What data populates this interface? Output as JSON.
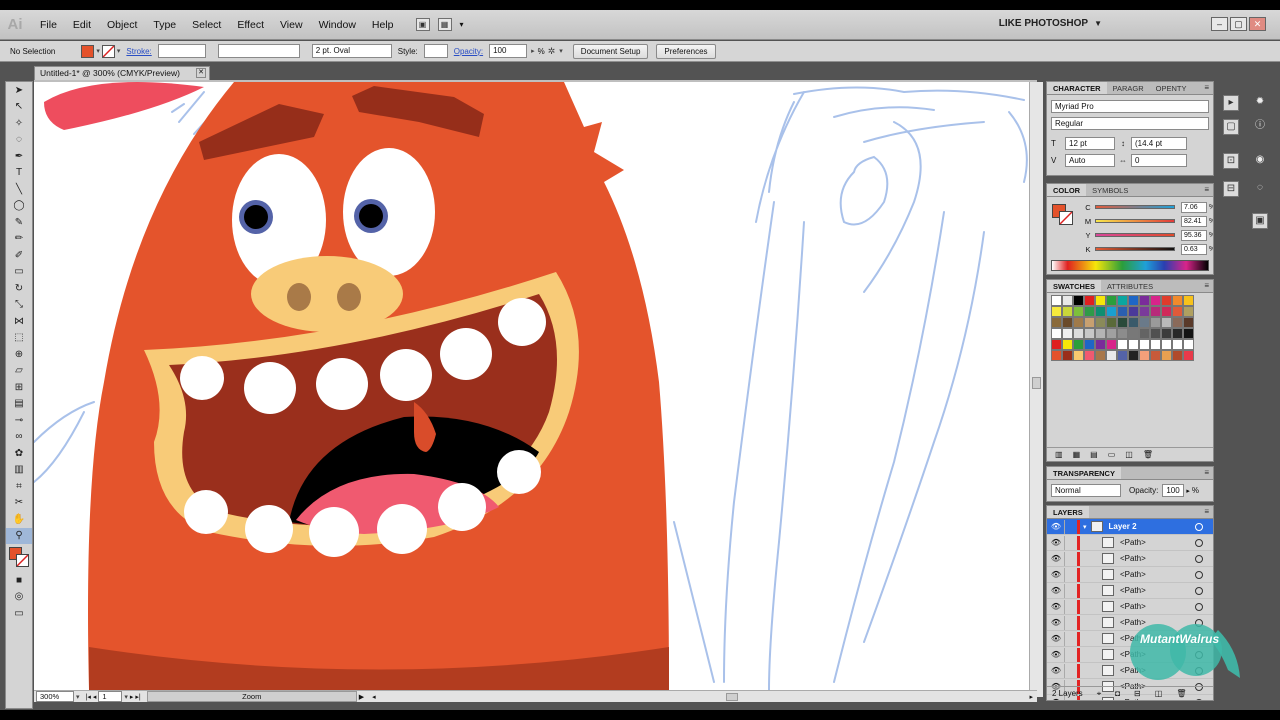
{
  "app": {
    "logo": "Ai",
    "workspace": "LIKE PHOTOSHOP"
  },
  "menu": [
    "File",
    "Edit",
    "Object",
    "Type",
    "Select",
    "Effect",
    "View",
    "Window",
    "Help"
  ],
  "window_buttons": [
    "–",
    "▢",
    "✕"
  ],
  "control": {
    "selection": "No Selection",
    "fill_color": "#e4522b",
    "stroke_label": "Stroke:",
    "brush": "2 pt. Oval",
    "style_label": "Style:",
    "opacity_label": "Opacity:",
    "opacity_value": "100",
    "pct": "%",
    "doc_setup": "Document Setup",
    "preferences": "Preferences"
  },
  "document": {
    "tab_title": "Untitled-1* @ 300% (CMYK/Preview)",
    "zoom": "300%",
    "artboard": "1",
    "status": "Zoom"
  },
  "character": {
    "tabs": [
      "CHARACTER",
      "PARAGR",
      "OPENTY"
    ],
    "font": "Myriad Pro",
    "style": "Regular",
    "size": "12 pt",
    "leading": "(14.4 pt",
    "kerning": "Auto",
    "tracking": "0"
  },
  "color": {
    "tabs": [
      "COLOR",
      "SYMBOLS"
    ],
    "channels": [
      {
        "label": "C",
        "value": "7.06",
        "pos": 0.07,
        "grad": "linear-gradient(90deg,#e25a3a,#1fa0d8)"
      },
      {
        "label": "M",
        "value": "82.41",
        "pos": 0.82,
        "grad": "linear-gradient(90deg,#f7e64b,#e03a3a)"
      },
      {
        "label": "Y",
        "value": "95.36",
        "pos": 0.95,
        "grad": "linear-gradient(90deg,#d8479a,#e04a2a)"
      },
      {
        "label": "K",
        "value": "0.63",
        "pos": 0.01,
        "grad": "linear-gradient(90deg,#e35a33,#111)"
      }
    ],
    "pct": "%"
  },
  "swatches": {
    "tabs": [
      "SWATCHES",
      "ATTRIBUTES"
    ],
    "rows": [
      [
        "#ffffff",
        "#e8e8e8",
        "#000000",
        "#e02020",
        "#f6e60a",
        "#2b9e3a",
        "#0aa6a0",
        "#1e66c6",
        "#7a2b9a",
        "#d8248a",
        "#e03c2c",
        "#f18a2c",
        "#f7c21b"
      ],
      [
        "#f7ea3c",
        "#c9d63a",
        "#7dbf3b",
        "#2f9a48",
        "#0f8e70",
        "#1a9fd0",
        "#2a5fb0",
        "#4a3a9a",
        "#7a3a9a",
        "#b82a7a",
        "#d02a5a",
        "#e05a3a",
        "#b0a060"
      ],
      [
        "#8a6a3a",
        "#6a4a2a",
        "#a07a4a",
        "#c8a070",
        "#8a8a5a",
        "#5a6a3a",
        "#2a4a3a",
        "#3a5a6a",
        "#6a7a8a",
        "#9a9a9a",
        "#bababa",
        "#8a6a5a",
        "#5a3a2a"
      ],
      [
        "#ffffff",
        "#f0f0f0",
        "#dcdcdc",
        "#c8c8c8",
        "#b4b4b4",
        "#a0a0a0",
        "#8c8c8c",
        "#787878",
        "#646464",
        "#505050",
        "#3c3c3c",
        "#282828",
        "#141414"
      ],
      [
        "#e02020",
        "#f6e60a",
        "#2b9e3a",
        "#1e66c6",
        "#7a2b9a",
        "#d8248a",
        "#ffffff",
        "#ffffff",
        "#ffffff",
        "#ffffff",
        "#ffffff",
        "#ffffff",
        "#ffffff"
      ],
      [
        "#e4522b",
        "#9a2e1a",
        "#f9c96f",
        "#f05a70",
        "#a8774a",
        "#e9e9e9",
        "#5463a8",
        "#222222",
        "#f4a07a",
        "#c85a3a",
        "#e8a050",
        "#b04a2a",
        "#e83a4a"
      ]
    ]
  },
  "transparency": {
    "title": "TRANSPARENCY",
    "mode": "Normal",
    "opacity_label": "Opacity:",
    "opacity_value": "100",
    "pct": "%"
  },
  "layers": {
    "title": "LAYERS",
    "layer_name": "Layer 2",
    "paths": [
      "<Path>",
      "<Path>",
      "<Path>",
      "<Path>",
      "<Path>",
      "<Path>",
      "<Path>",
      "<Path>",
      "<Path>",
      "<Path>",
      "<Path>"
    ],
    "count": "2 Layers"
  },
  "watermark": {
    "text": "MutantWalrus"
  }
}
